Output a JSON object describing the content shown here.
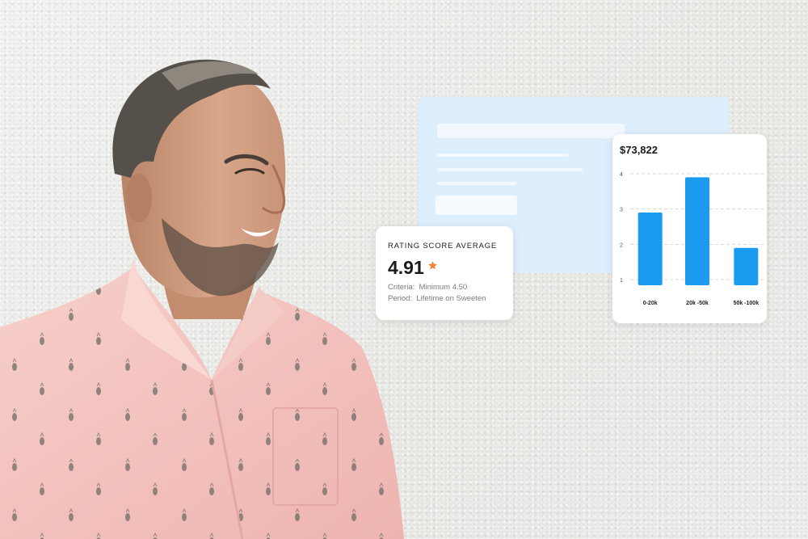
{
  "rating_card": {
    "title": "RATING SCORE AVERAGE",
    "value": "4.91",
    "criteria_label": "Criteria:",
    "criteria_value": "Minimum 4.50",
    "period_label": "Period:",
    "period_value": "Lifetime on Sweeten",
    "star_color": "#f5823a",
    "star_icon": "star-icon"
  },
  "chart_card": {
    "total": "$73,822"
  },
  "chart_data": {
    "type": "bar",
    "categories": [
      "0-20k",
      "20k -50k",
      "50k -100k"
    ],
    "values": [
      2.9,
      3.9,
      1.9
    ],
    "ylim": [
      1,
      4
    ],
    "yticks": [
      "1",
      "2",
      "3",
      "4"
    ],
    "grid": true,
    "bar_color": "#1a9bf0"
  },
  "colors": {
    "form_card": "#ddeefc",
    "shirt": "#f4c3c0",
    "wall": "#eeeeec"
  }
}
